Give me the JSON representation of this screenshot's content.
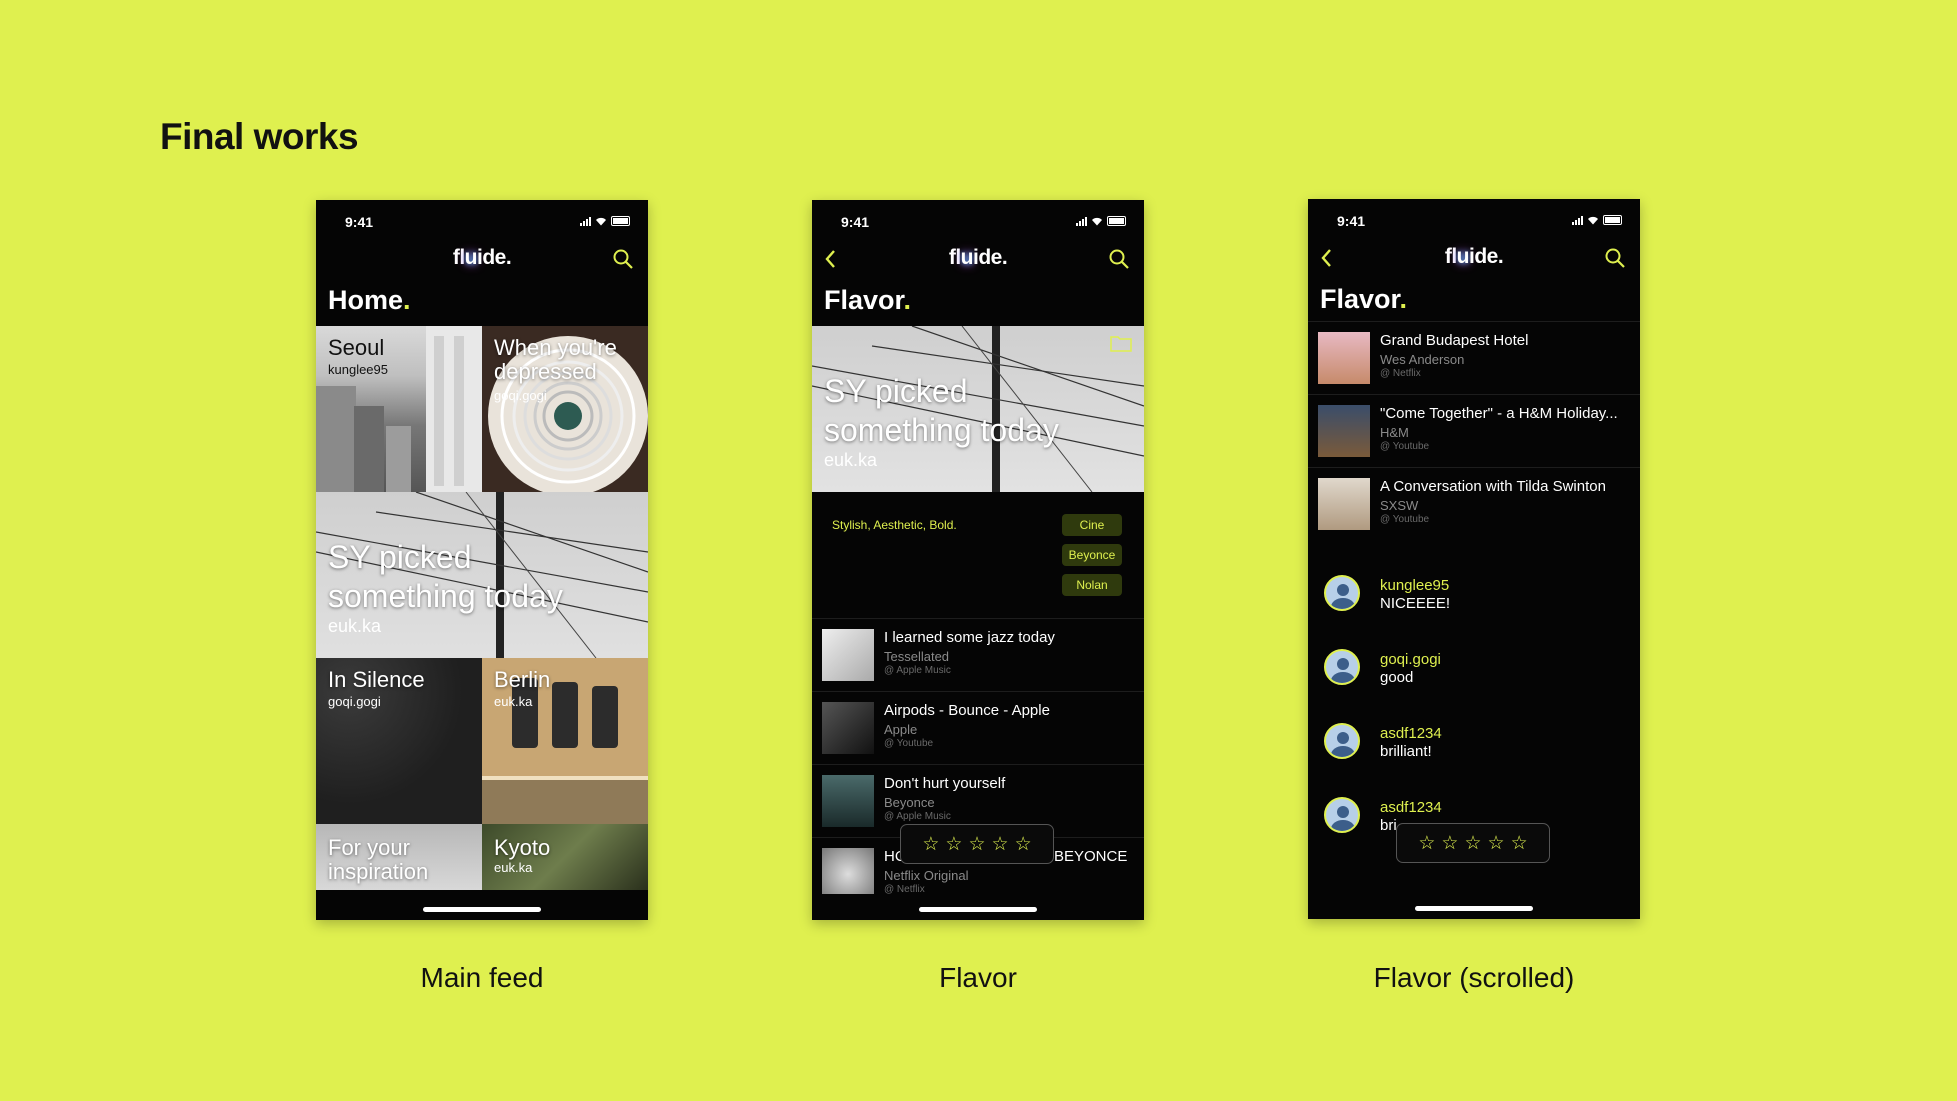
{
  "title": "Final works",
  "accent": "#dff04f",
  "status": {
    "time": "9:41"
  },
  "logo": {
    "a": "fl",
    "u": "u",
    "b": "ide."
  },
  "icons": {
    "search": "search-icon",
    "back": "chevron-left-icon",
    "folder": "folder-icon",
    "star": "star-outline-icon"
  },
  "screens": {
    "main": {
      "caption": "Main feed",
      "heading": "Home",
      "tiles": [
        {
          "title": "Seoul",
          "sub": "kunglee95"
        },
        {
          "title": "When you're depressed",
          "sub": "goqi.gogi"
        },
        {
          "title": "SY picked something today",
          "sub": "euk.ka"
        },
        {
          "title": "In Silence",
          "sub": "goqi.gogi"
        },
        {
          "title": "Berlin",
          "sub": "euk.ka"
        },
        {
          "title": "For your inspiration",
          "sub": ""
        },
        {
          "title": "Kyoto",
          "sub": "euk.ka"
        }
      ]
    },
    "flavor": {
      "caption": "Flavor",
      "heading": "Flavor",
      "hero_title": "SY picked something today",
      "hero_user": "euk.ka",
      "description": "Stylish, Aesthetic, Bold.",
      "tags": [
        "Cine",
        "Beyonce",
        "Nolan"
      ],
      "items": [
        {
          "title": "I learned some jazz today",
          "artist": "Tessellated",
          "source": "@ Apple Music"
        },
        {
          "title": "Airpods - Bounce - Apple",
          "artist": "Apple",
          "source": "@ Youtube"
        },
        {
          "title": "Don't hurt yourself",
          "artist": "Beyonce",
          "source": "@ Apple Music"
        },
        {
          "title_left": "HC",
          "title_right": "BEYONCE",
          "artist": "Netflix Original",
          "source": "@ Netflix"
        }
      ]
    },
    "flavor_scrolled": {
      "caption": "Flavor (scrolled)",
      "heading": "Flavor",
      "items": [
        {
          "title": "Grand Budapest Hotel",
          "artist": "Wes Anderson",
          "source": "@ Netflix"
        },
        {
          "title": "\"Come Together\" - a H&M Holiday...",
          "artist": "H&M",
          "source": "@ Youtube"
        },
        {
          "title": "A Conversation with Tilda Swinton",
          "artist": "SXSW",
          "source": "@ Youtube"
        }
      ],
      "comments": [
        {
          "user": "kunglee95",
          "text": "NICEEEE!"
        },
        {
          "user": "goqi.gogi",
          "text": "good"
        },
        {
          "user": "asdf1234",
          "text": "brilliant!"
        },
        {
          "user": "asdf1234",
          "text": "bri"
        }
      ]
    }
  }
}
